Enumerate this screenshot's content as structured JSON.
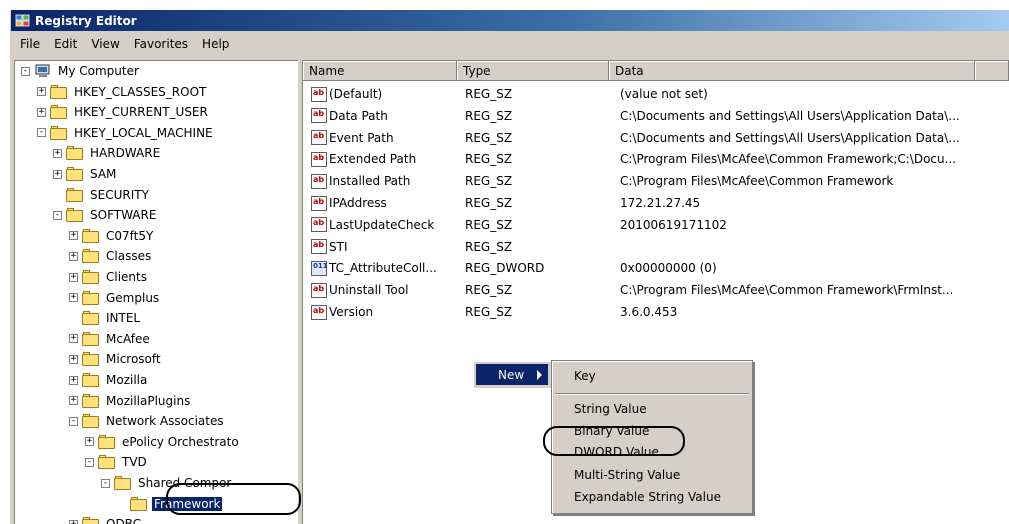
{
  "window": {
    "title": "Registry Editor"
  },
  "menubar": [
    {
      "label": "File"
    },
    {
      "label": "Edit"
    },
    {
      "label": "View"
    },
    {
      "label": "Favorites"
    },
    {
      "label": "Help"
    }
  ],
  "tree": [
    {
      "label": "My Computer",
      "expander": "−",
      "indent": 0,
      "icon": "computer"
    },
    {
      "label": "HKEY_CLASSES_ROOT",
      "expander": "+",
      "indent": 1
    },
    {
      "label": "HKEY_CURRENT_USER",
      "expander": "+",
      "indent": 1
    },
    {
      "label": "HKEY_LOCAL_MACHINE",
      "expander": "−",
      "indent": 1
    },
    {
      "label": "HARDWARE",
      "expander": "+",
      "indent": 2
    },
    {
      "label": "SAM",
      "expander": "+",
      "indent": 2
    },
    {
      "label": "SECURITY",
      "expander": "",
      "indent": 2
    },
    {
      "label": "SOFTWARE",
      "expander": "−",
      "indent": 2
    },
    {
      "label": "C07ft5Y",
      "expander": "+",
      "indent": 3
    },
    {
      "label": "Classes",
      "expander": "+",
      "indent": 3
    },
    {
      "label": "Clients",
      "expander": "+",
      "indent": 3
    },
    {
      "label": "Gemplus",
      "expander": "+",
      "indent": 3
    },
    {
      "label": "INTEL",
      "expander": "",
      "indent": 3
    },
    {
      "label": "McAfee",
      "expander": "+",
      "indent": 3
    },
    {
      "label": "Microsoft",
      "expander": "+",
      "indent": 3
    },
    {
      "label": "Mozilla",
      "expander": "+",
      "indent": 3
    },
    {
      "label": "MozillaPlugins",
      "expander": "+",
      "indent": 3
    },
    {
      "label": "Network Associates",
      "expander": "−",
      "indent": 3
    },
    {
      "label": "ePolicy Orchestrato",
      "expander": "+",
      "indent": 4
    },
    {
      "label": "TVD",
      "expander": "−",
      "indent": 4
    },
    {
      "label": "Shared Compor",
      "expander": "−",
      "indent": 5
    },
    {
      "label": "Framework",
      "expander": "",
      "indent": 6,
      "selected": true
    },
    {
      "label": "ODBC",
      "expander": "+",
      "indent": 3
    }
  ],
  "columns": {
    "name": "Name",
    "type": "Type",
    "data": "Data"
  },
  "values": [
    {
      "name": "(Default)",
      "type": "REG_SZ",
      "data": "(value not set)",
      "icon": "string-value-icon"
    },
    {
      "name": "Data Path",
      "type": "REG_SZ",
      "data": "C:\\Documents and Settings\\All Users\\Application Data\\...",
      "icon": "string-value-icon"
    },
    {
      "name": "Event Path",
      "type": "REG_SZ",
      "data": "C:\\Documents and Settings\\All Users\\Application Data\\...",
      "icon": "string-value-icon"
    },
    {
      "name": "Extended Path",
      "type": "REG_SZ",
      "data": "C:\\Program Files\\McAfee\\Common Framework;C:\\Docu...",
      "icon": "string-value-icon"
    },
    {
      "name": "Installed Path",
      "type": "REG_SZ",
      "data": "C:\\Program Files\\McAfee\\Common Framework",
      "icon": "string-value-icon"
    },
    {
      "name": "IPAddress",
      "type": "REG_SZ",
      "data": "172.21.27.45",
      "icon": "string-value-icon"
    },
    {
      "name": "LastUpdateCheck",
      "type": "REG_SZ",
      "data": "20100619171102",
      "icon": "string-value-icon"
    },
    {
      "name": "STI",
      "type": "REG_SZ",
      "data": "",
      "icon": "string-value-icon"
    },
    {
      "name": "TC_AttributeColl...",
      "type": "REG_DWORD",
      "data": "0x00000000 (0)",
      "icon": "dword-value-icon"
    },
    {
      "name": "Uninstall Tool",
      "type": "REG_SZ",
      "data": "C:\\Program Files\\McAfee\\Common Framework\\FrmInst...",
      "icon": "string-value-icon"
    },
    {
      "name": "Version",
      "type": "REG_SZ",
      "data": "3.6.0.453",
      "icon": "string-value-icon"
    }
  ],
  "context_menu": {
    "new_label": "New"
  },
  "submenu": {
    "items": [
      {
        "label": "Key"
      },
      {
        "label": "String Value"
      },
      {
        "label": "Binary Value"
      },
      {
        "label": "DWORD Value"
      },
      {
        "label": "Multi-String Value"
      },
      {
        "label": "Expandable String Value"
      }
    ]
  },
  "colors": {
    "selection": "#0a246a",
    "titlebar_start": "#0a246a",
    "titlebar_end": "#a6caf0",
    "chrome": "#d4d0c8"
  }
}
